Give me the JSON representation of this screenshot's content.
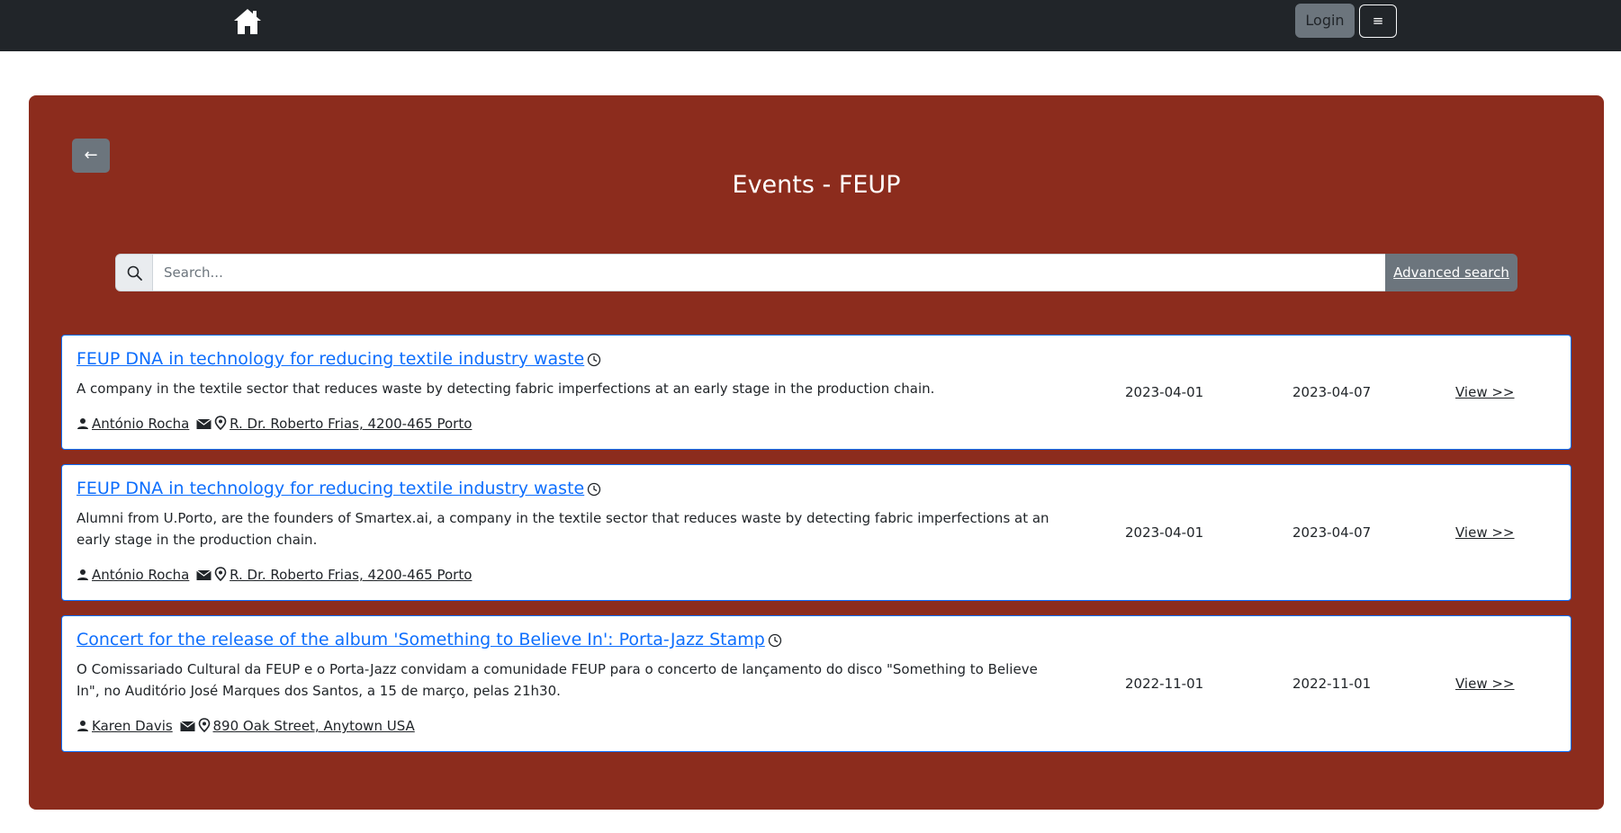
{
  "nav": {
    "login_label": "Login",
    "menu_label": "≡"
  },
  "page": {
    "back_label": "←",
    "title": "Events - FEUP"
  },
  "search": {
    "placeholder": "Search...",
    "value": "",
    "advanced_label": "Advanced search"
  },
  "events": [
    {
      "title": "FEUP DNA in technology for reducing textile industry waste",
      "description": "A company in the textile sector that reduces waste by detecting fabric imperfections at an early stage in the production chain.",
      "organizer": "António Rocha",
      "location": "R. Dr. Roberto Frias, 4200-465 Porto",
      "start_date": "2023-04-01",
      "end_date": "2023-04-07",
      "view_label": "View >>"
    },
    {
      "title": "FEUP DNA in technology for reducing textile industry waste",
      "description": "Alumni from U.Porto, are the founders of Smartex.ai, a company in the textile sector that reduces waste by detecting fabric imperfections at an early stage in the production chain.",
      "organizer": "António Rocha",
      "location": "R. Dr. Roberto Frias, 4200-465 Porto",
      "start_date": "2023-04-01",
      "end_date": "2023-04-07",
      "view_label": "View >>"
    },
    {
      "title": "Concert for the release of the album 'Something to Believe In': Porta-Jazz Stamp",
      "description": "O Comissariado Cultural da FEUP e o Porta-Jazz convidam a comunidade FEUP para o concerto de lançamento do disco \"Something to Believe In\", no Auditório José Marques dos Santos, a 15 de março, pelas 21h30.",
      "organizer": "Karen Davis",
      "location": "890 Oak Street, Anytown USA",
      "start_date": "2022-11-01",
      "end_date": "2022-11-01",
      "view_label": "View >>"
    }
  ],
  "colors": {
    "nav_bg": "#212529",
    "panel_bg": "#8c2c1d",
    "link_blue": "#0d6efd",
    "secondary": "#6c757d"
  },
  "icons": [
    "home-icon",
    "search-icon",
    "clock-icon",
    "person-icon",
    "envelope-icon",
    "map-pin-icon"
  ]
}
